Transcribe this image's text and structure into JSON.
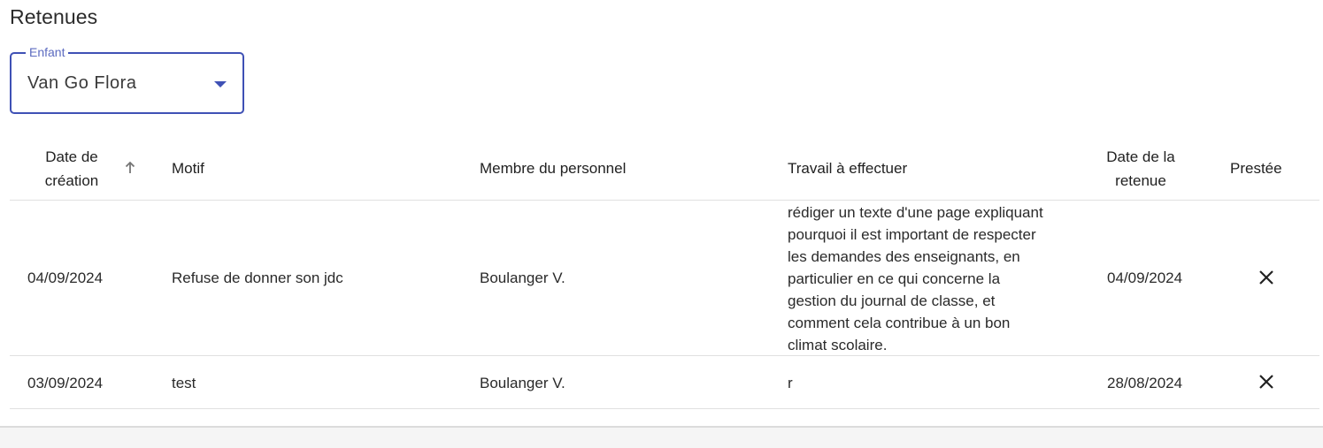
{
  "page": {
    "title": "Retenues"
  },
  "child_select": {
    "label": "Enfant",
    "value": "Van Go Flora",
    "accent_color": "#3f51b5"
  },
  "table": {
    "columns": {
      "creation_date": "Date de création",
      "creation_date_line1": "Date de",
      "creation_date_line2": "création",
      "reason": "Motif",
      "staff": "Membre du personnel",
      "work": "Travail à effectuer",
      "detention_date_line1": "Date de la",
      "detention_date_line2": "retenue",
      "done": "Prestée"
    },
    "sort": {
      "column": "creation_date",
      "direction": "ascending",
      "icon": "arrow-up-icon"
    },
    "rows": [
      {
        "creation_date": "04/09/2024",
        "reason": "Refuse de donner son jdc",
        "staff": "Boulanger V.",
        "work_lines": [
          "rédiger un texte d'une page expliquant",
          "pourquoi il est important de respecter",
          "les demandes des enseignants, en",
          "particulier en ce qui concerne la",
          "gestion du journal de classe, et",
          "comment cela contribue à un bon",
          "climat scolaire."
        ],
        "detention_date": "04/09/2024",
        "done_icon": "close-icon"
      },
      {
        "creation_date": "03/09/2024",
        "reason": "test",
        "staff": "Boulanger V.",
        "work_lines": [
          "r"
        ],
        "detention_date": "28/08/2024",
        "done_icon": "close-icon"
      }
    ]
  }
}
